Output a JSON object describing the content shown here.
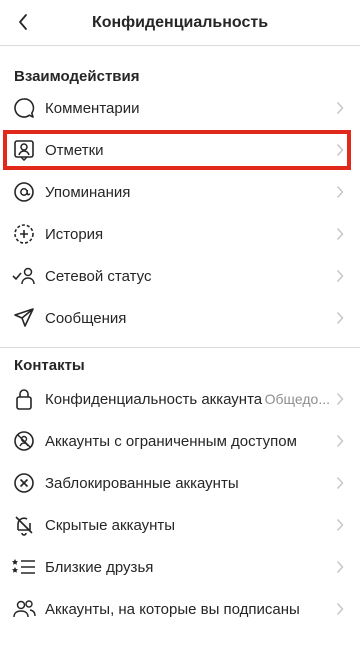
{
  "header": {
    "title": "Конфиденциальность",
    "back_icon": "chevron-left-icon"
  },
  "sections": {
    "interactions": {
      "title": "Взаимодействия",
      "items": [
        {
          "label": "Комментарии",
          "icon": "comment-icon"
        },
        {
          "label": "Отметки",
          "icon": "tag-person-icon",
          "highlighted": true
        },
        {
          "label": "Упоминания",
          "icon": "at-sign-icon"
        },
        {
          "label": "История",
          "icon": "story-plus-icon"
        },
        {
          "label": "Сетевой статус",
          "icon": "activity-status-icon"
        },
        {
          "label": "Сообщения",
          "icon": "send-icon"
        }
      ]
    },
    "contacts": {
      "title": "Контакты",
      "items": [
        {
          "label": "Конфиденциальность аккаунта",
          "value": "Общедо...",
          "icon": "lock-icon"
        },
        {
          "label": "Аккаунты с ограниченным доступом",
          "icon": "restricted-icon"
        },
        {
          "label": "Заблокированные аккаунты",
          "icon": "blocked-icon"
        },
        {
          "label": "Скрытые аккаунты",
          "icon": "muted-bell-icon"
        },
        {
          "label": "Близкие друзья",
          "icon": "close-friends-icon"
        },
        {
          "label": "Аккаунты, на которые вы подписаны",
          "icon": "following-icon"
        }
      ]
    }
  },
  "colors": {
    "highlight": "#e0281b",
    "text": "#262626",
    "secondary": "#8e8e8e",
    "divider": "#dbdbdb"
  }
}
